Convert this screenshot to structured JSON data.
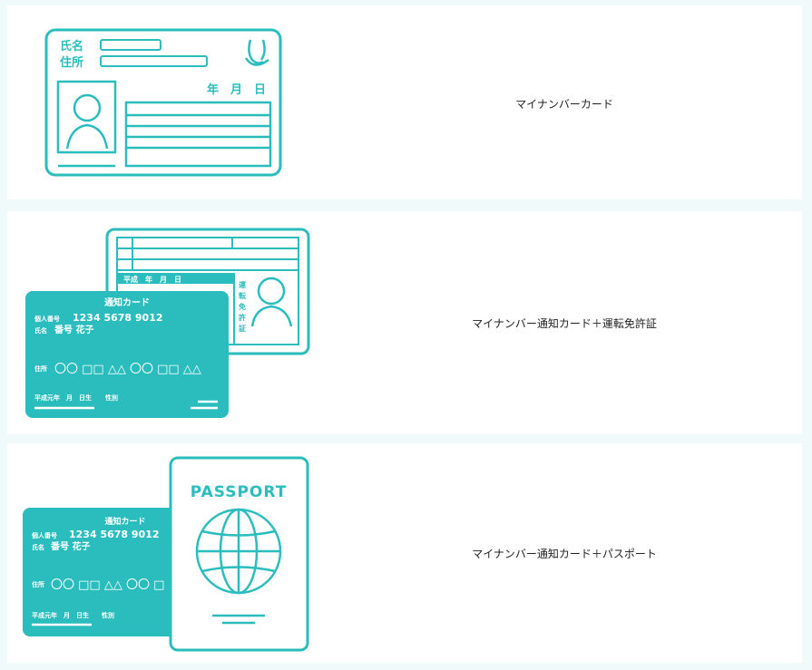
{
  "colors": {
    "teal": "#2bbdbd",
    "row_bg": "#ffffff",
    "page_bg": "#f1fafa"
  },
  "options": [
    {
      "label": "マイナンバーカード",
      "card": {
        "name_label": "氏名",
        "address_label": "住所",
        "date_label": "年　月　日"
      }
    },
    {
      "label": "マイナンバー通知カード＋運転免許証",
      "license": {
        "era_date": "平成　年　月　日",
        "vertical_label": [
          "運",
          "転",
          "免",
          "許",
          "証"
        ]
      },
      "notice_card": {
        "title": "通知カード",
        "number_label": "個人番号",
        "number": "1234 5678 9012",
        "name_label": "氏名",
        "name": "番号 花子",
        "address_label": "住所",
        "symbols": "〇〇 □□ △△ 〇〇 □□ △△",
        "birth_label": "平成元年　月　日生",
        "gender_label": "性別"
      }
    },
    {
      "label": "マイナンバー通知カード＋パスポート",
      "passport": {
        "title": "PASSPORT"
      },
      "notice_card": {
        "title": "通知カード",
        "number_label": "個人番号",
        "number": "1234 5678 9012",
        "name_label": "氏名",
        "name": "番号 花子",
        "address_label": "住所",
        "symbols": "〇〇 □□ △△ 〇〇 □",
        "birth_label": "平成元年　月　日生",
        "gender_label": "性別"
      }
    }
  ]
}
